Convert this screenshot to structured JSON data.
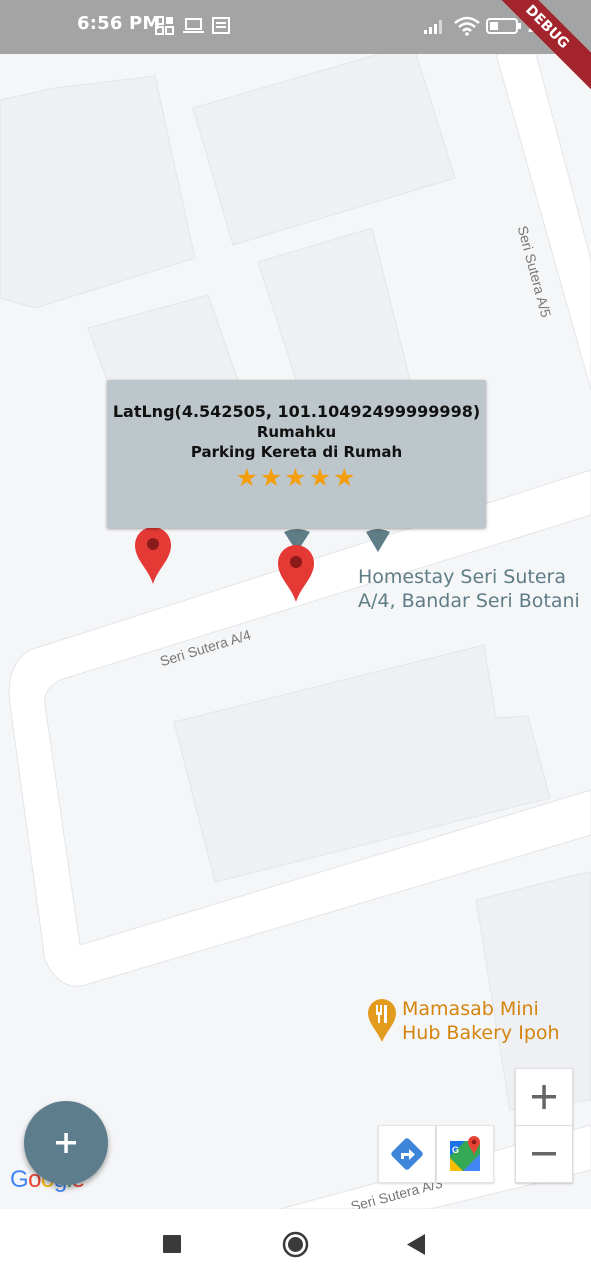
{
  "status_bar": {
    "time": "6:56 PM",
    "battery": "27",
    "icons": [
      "apps-icon",
      "laptop-icon",
      "news-icon",
      "signal-icon",
      "wifi-icon",
      "battery-icon"
    ]
  },
  "debug_banner": "DEBUG",
  "map": {
    "street_labels": [
      "Seri Sutera A/5",
      "Seri Sutera A/4",
      "Seri Sutera A/3"
    ],
    "poi_homestay": {
      "line1": "Homestay Seri Sutera",
      "line2": "A/4, Bandar Seri Botani",
      "color": "#5f7d87"
    },
    "poi_bakery": {
      "line1": "Mamasab Mini",
      "line2": "Hub Bakery Ipoh",
      "color": "#d4850f"
    },
    "marker_color": "#e53935"
  },
  "info_window": {
    "coords": "LatLng(4.542505, 101.10492499999998)",
    "title": "Rumahku",
    "snippet": "Parking Kereta di Rumah",
    "stars": "★★★★★",
    "rating": 5,
    "star_color": "#f59e0b"
  },
  "controls": {
    "zoom_in": "+",
    "zoom_out": "−",
    "fab": "+",
    "fab_color": "#5e7d8c"
  },
  "google_logo": {
    "letters": [
      "G",
      "o",
      "o",
      "g",
      "l",
      "e"
    ]
  }
}
